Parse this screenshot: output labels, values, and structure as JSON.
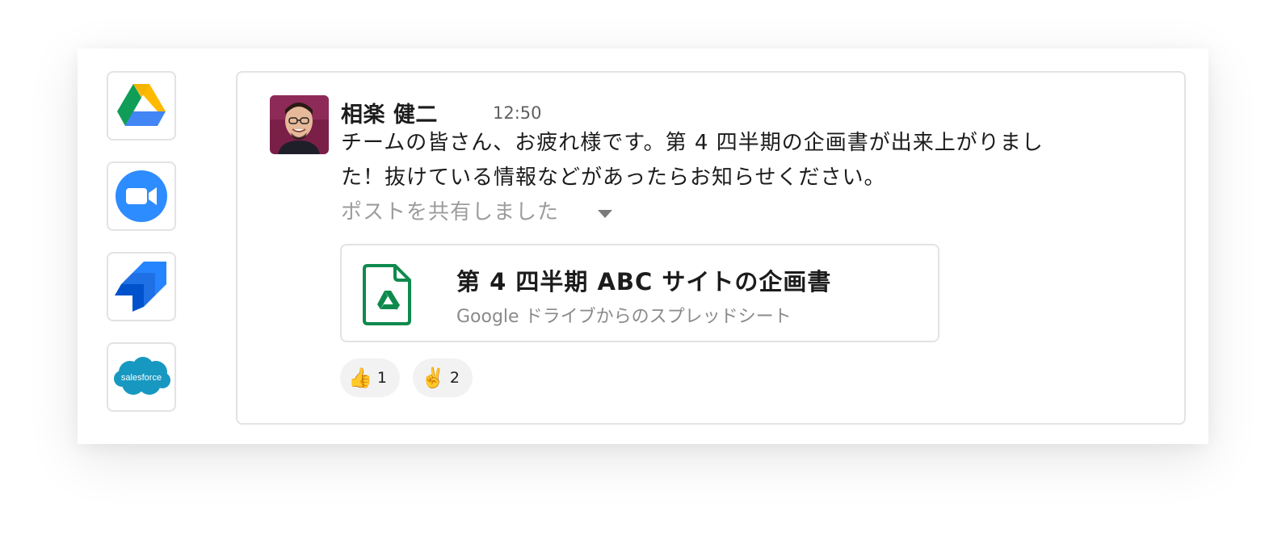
{
  "app_rail": {
    "apps": [
      {
        "name": "Google Drive",
        "icon": "google-drive-icon"
      },
      {
        "name": "Zoom",
        "icon": "zoom-icon",
        "color": "#2D8CFF"
      },
      {
        "name": "Jira",
        "icon": "jira-icon",
        "color": "#2684FF"
      },
      {
        "name": "Salesforce",
        "icon": "salesforce-icon",
        "label": "salesforce",
        "color": "#1798c1"
      }
    ]
  },
  "message": {
    "author": "相楽 健二",
    "time": "12:50",
    "text": "チームの皆さん、お疲れ様です。第 4 四半期の企画書が出来上がりました！抜けている情報などがあったらお知らせください。",
    "shared_label": "ポストを共有しました"
  },
  "attachment": {
    "title": "第 4 四半期 ABC サイトの企画書",
    "subtitle": "Google ドライブからのスプレッドシート",
    "icon": "google-sheets-file-icon",
    "accent": "#0f8a4d"
  },
  "reactions": [
    {
      "emoji": "👍",
      "count": "1"
    },
    {
      "emoji": "✌️",
      "count": "2"
    }
  ]
}
